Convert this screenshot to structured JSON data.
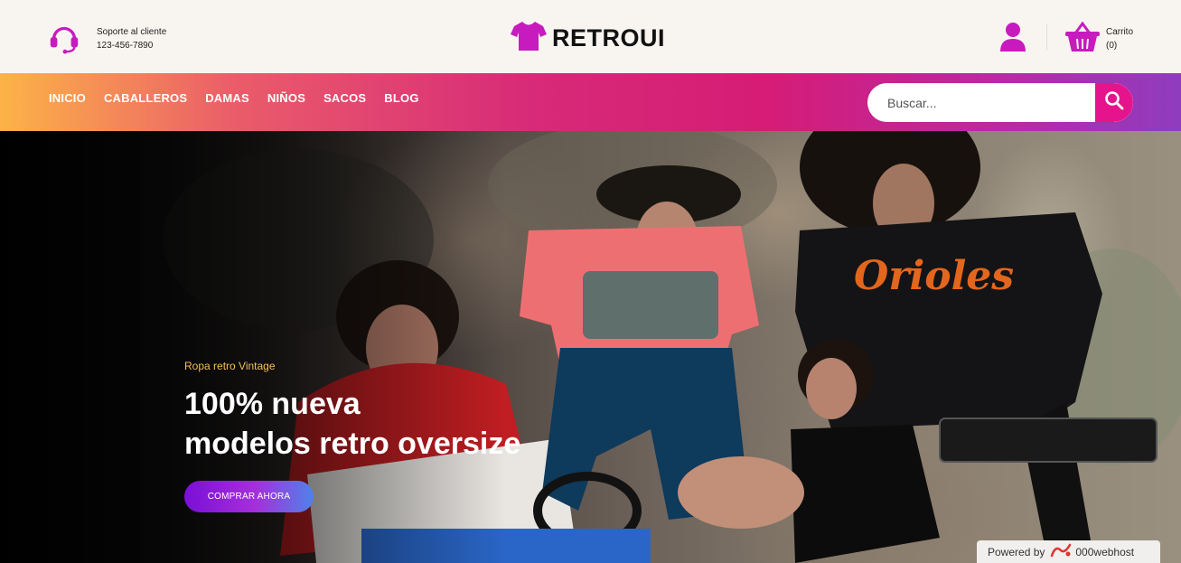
{
  "header": {
    "support_label": "Soporte al cliente",
    "support_phone": "123-456-7890",
    "brand": "RETROUI",
    "cart_label": "Carrito",
    "cart_count": "(0)",
    "icons": [
      "headset-icon",
      "tshirt-icon",
      "user-icon",
      "basket-icon"
    ]
  },
  "nav": {
    "items": [
      "INICIO",
      "CABALLEROS",
      "DAMAS",
      "NIÑOS",
      "SACOS",
      "BLOG"
    ]
  },
  "search": {
    "placeholder": "Buscar...",
    "value": ""
  },
  "hero": {
    "subtitle": "Ropa retro Vintage",
    "title_line1": "100% nueva",
    "title_line2": "modelos retro oversize",
    "cta": "COMPRAR AHORA"
  },
  "footer_badge": {
    "prefix": "Powered by",
    "brand": "000webhost"
  },
  "colors": {
    "accent": "#c81bbf",
    "search_button": "#e6148c",
    "hero_subtitle": "#f4bf5a"
  }
}
